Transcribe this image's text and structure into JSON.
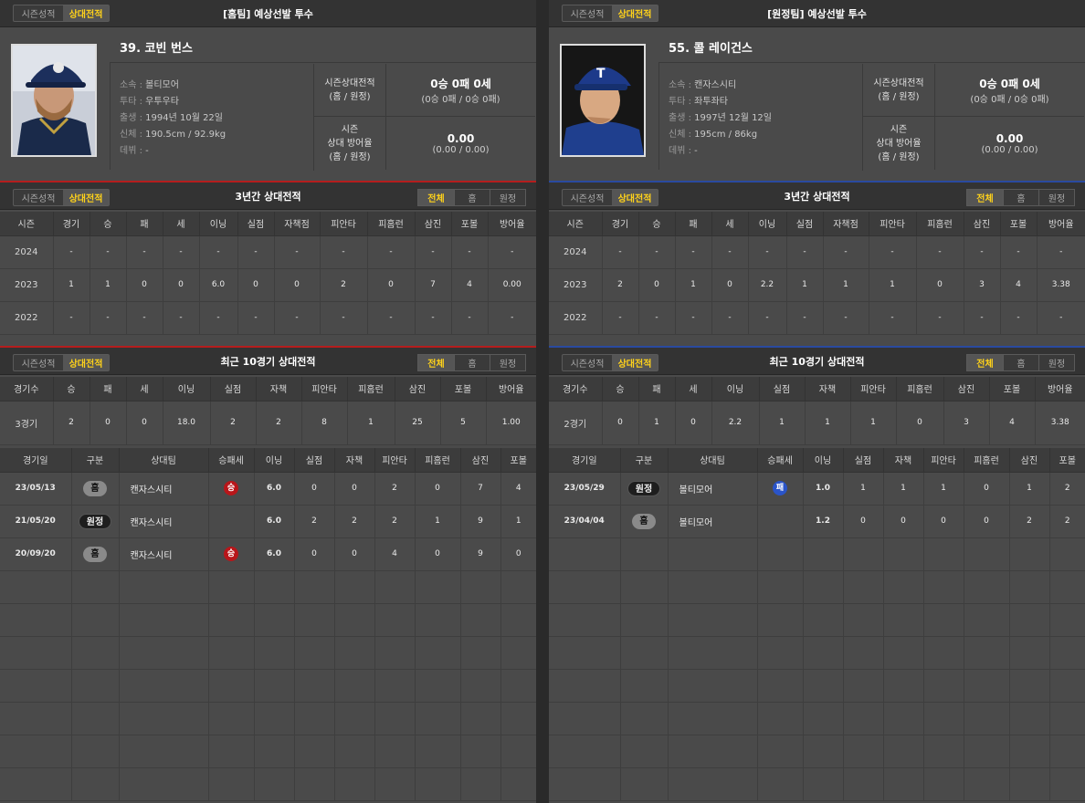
{
  "tabs": {
    "season": "시즌성적",
    "vs": "상대전적"
  },
  "filters": [
    "전체",
    "홈",
    "원정"
  ],
  "left": {
    "header": "[홈팀] 예상선발 투수",
    "name": "39. 코빈 번스",
    "info": {
      "team_label": "소속",
      "team": "볼티모어",
      "throw_label": "투타",
      "throw": "우투우타",
      "birth_label": "출생",
      "birth": "1994년 10월 22일",
      "body_label": "신체",
      "body": "190.5cm / 92.9kg",
      "debut_label": "데뷔",
      "debut": "-"
    },
    "season_record_label_1": "시즌상대전적",
    "season_record_label_2": "(홈 / 원정)",
    "season_record": "0승 0패 0세",
    "season_record_sub": "(0승 0패 / 0승 0패)",
    "era_label_1": "시즌",
    "era_label_2": "상대 방어율",
    "era_label_3": "(홈 / 원정)",
    "era": "0.00",
    "era_sub": "(0.00 / 0.00)",
    "three_year_title": "3년간 상대전적",
    "three_year_rows": [
      [
        "2024",
        "-",
        "-",
        "-",
        "-",
        "-",
        "-",
        "-",
        "-",
        "-",
        "-",
        "-",
        "-"
      ],
      [
        "2023",
        "1",
        "1",
        "0",
        "0",
        "6.0",
        "0",
        "0",
        "2",
        "0",
        "7",
        "4",
        "0.00"
      ],
      [
        "2022",
        "-",
        "-",
        "-",
        "-",
        "-",
        "-",
        "-",
        "-",
        "-",
        "-",
        "-",
        "-"
      ]
    ],
    "recent_title": "최근 10경기 상대전적",
    "recent_summary": [
      "3경기",
      "2",
      "0",
      "0",
      "18.0",
      "2",
      "2",
      "8",
      "1",
      "25",
      "5",
      "1.00"
    ],
    "games": [
      {
        "date": "23/05/13",
        "type": "홈",
        "kind": "home",
        "team": "캔자스시티",
        "result": "승",
        "res": "win",
        "ip": "6.0",
        "r": "0",
        "er": "0",
        "h": "2",
        "hr": "0",
        "so": "7",
        "bb": "4"
      },
      {
        "date": "21/05/20",
        "type": "원정",
        "kind": "away",
        "team": "캔자스시티",
        "result": "",
        "res": "",
        "ip": "6.0",
        "r": "2",
        "er": "2",
        "h": "2",
        "hr": "1",
        "so": "9",
        "bb": "1"
      },
      {
        "date": "20/09/20",
        "type": "홈",
        "kind": "home",
        "team": "캔자스시티",
        "result": "승",
        "res": "win",
        "ip": "6.0",
        "r": "0",
        "er": "0",
        "h": "4",
        "hr": "0",
        "so": "9",
        "bb": "0"
      }
    ]
  },
  "right": {
    "header": "[원정팀] 예상선발 투수",
    "name": "55. 콜 레이건스",
    "info": {
      "team_label": "소속",
      "team": "캔자스시티",
      "throw_label": "투타",
      "throw": "좌투좌타",
      "birth_label": "출생",
      "birth": "1997년 12월 12일",
      "body_label": "신체",
      "body": "195cm / 86kg",
      "debut_label": "데뷔",
      "debut": "-"
    },
    "season_record_label_1": "시즌상대전적",
    "season_record_label_2": "(홈 / 원정)",
    "season_record": "0승 0패 0세",
    "season_record_sub": "(0승 0패 / 0승 0패)",
    "era_label_1": "시즌",
    "era_label_2": "상대 방어율",
    "era_label_3": "(홈 / 원정)",
    "era": "0.00",
    "era_sub": "(0.00 / 0.00)",
    "three_year_title": "3년간 상대전적",
    "three_year_rows": [
      [
        "2024",
        "-",
        "-",
        "-",
        "-",
        "-",
        "-",
        "-",
        "-",
        "-",
        "-",
        "-",
        "-"
      ],
      [
        "2023",
        "2",
        "0",
        "1",
        "0",
        "2.2",
        "1",
        "1",
        "1",
        "0",
        "3",
        "4",
        "3.38"
      ],
      [
        "2022",
        "-",
        "-",
        "-",
        "-",
        "-",
        "-",
        "-",
        "-",
        "-",
        "-",
        "-",
        "-"
      ]
    ],
    "recent_title": "최근 10경기 상대전적",
    "recent_summary": [
      "2경기",
      "0",
      "1",
      "0",
      "2.2",
      "1",
      "1",
      "1",
      "0",
      "3",
      "4",
      "3.38"
    ],
    "games": [
      {
        "date": "23/05/29",
        "type": "원정",
        "kind": "away",
        "team": "볼티모어",
        "result": "패",
        "res": "loss",
        "ip": "1.0",
        "r": "1",
        "er": "1",
        "h": "1",
        "hr": "0",
        "so": "1",
        "bb": "2"
      },
      {
        "date": "23/04/04",
        "type": "홈",
        "kind": "home",
        "team": "볼티모어",
        "result": "",
        "res": "",
        "ip": "1.2",
        "r": "0",
        "er": "0",
        "h": "0",
        "hr": "0",
        "so": "2",
        "bb": "2"
      }
    ]
  },
  "three_year_headers": [
    "시즌",
    "경기",
    "승",
    "패",
    "세",
    "이닝",
    "실점",
    "자책점",
    "피안타",
    "피홈런",
    "삼진",
    "포볼",
    "방어율"
  ],
  "recent_headers": [
    "경기수",
    "승",
    "패",
    "세",
    "이닝",
    "실점",
    "자책",
    "피안타",
    "피홈런",
    "삼진",
    "포볼",
    "방어율"
  ],
  "game_headers": [
    "경기일",
    "구분",
    "상대팀",
    "승패세",
    "이닝",
    "실점",
    "자책",
    "피안타",
    "피홈런",
    "삼진",
    "포볼"
  ],
  "colors": {
    "accent_yellow": "#ffd21a",
    "home_line": "#b51d1d",
    "away_line": "#2a4aa0",
    "win": "#b8161a",
    "loss": "#2a54c8"
  }
}
